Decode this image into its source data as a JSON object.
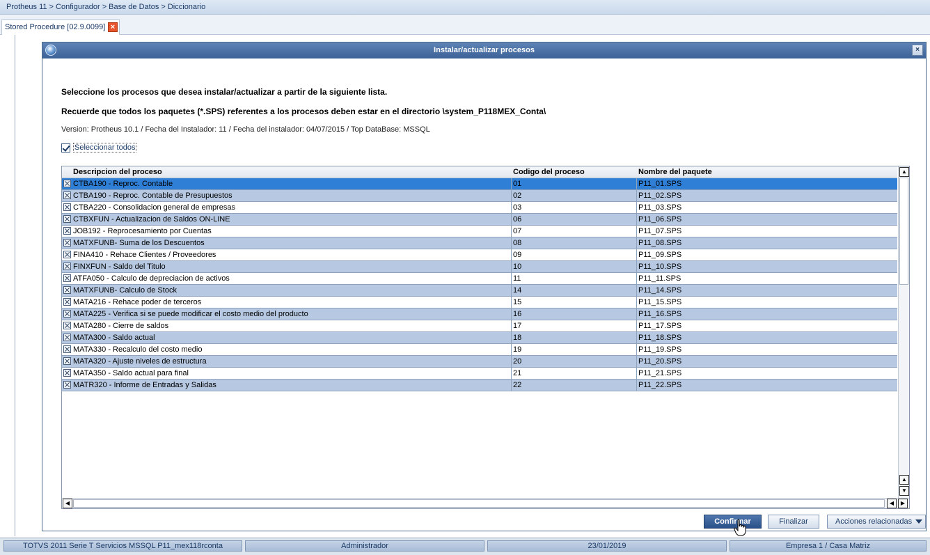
{
  "breadcrumb": "Protheus 11 > Configurador > Base de Datos > Diccionario",
  "tab": {
    "label": "Stored Procedure [02.9.0099]",
    "close_glyph": "×"
  },
  "dialog": {
    "title": "Instalar/actualizar procesos",
    "close_glyph": "×",
    "instruction1": "Seleccione los procesos que desea instalar/actualizar a partir de la siguiente lista.",
    "instruction2": "Recuerde que todos los paquetes (*.SPS) referentes a los procesos deben estar en el directorio \\system_P118MEX_Conta\\",
    "version_info": "Version: Protheus 10.1 / Fecha del Instalador: 11 / Fecha del instalador: 04/07/2015 / Top DataBase: MSSQL",
    "select_all_label": "Seleccionar todos",
    "select_all_checked": true
  },
  "table": {
    "columns": [
      "Descripcion del proceso",
      "Codigo del proceso",
      "Nombre del paquete"
    ],
    "selected_index": 0,
    "rows": [
      {
        "desc": "CTBA190 - Reproc. Contable",
        "code": "01",
        "pkg": "P11_01.SPS"
      },
      {
        "desc": "CTBA190 - Reproc. Contable de Presupuestos",
        "code": "02",
        "pkg": "P11_02.SPS"
      },
      {
        "desc": "CTBA220 - Consolidacion general de empresas",
        "code": "03",
        "pkg": "P11_03.SPS"
      },
      {
        "desc": "CTBXFUN - Actualizacion de Saldos ON-LINE",
        "code": "06",
        "pkg": "P11_06.SPS"
      },
      {
        "desc": "JOB192 - Reprocesamiento por Cuentas",
        "code": "07",
        "pkg": "P11_07.SPS"
      },
      {
        "desc": "MATXFUNB- Suma de los Descuentos",
        "code": "08",
        "pkg": "P11_08.SPS"
      },
      {
        "desc": "FINA410 - Rehace Clientes / Proveedores",
        "code": "09",
        "pkg": "P11_09.SPS"
      },
      {
        "desc": "FINXFUN - Saldo del Titulo",
        "code": "10",
        "pkg": "P11_10.SPS"
      },
      {
        "desc": "ATFA050 - Calculo de depreciacion de activos",
        "code": "11",
        "pkg": "P11_11.SPS"
      },
      {
        "desc": "MATXFUNB- Calculo de Stock",
        "code": "14",
        "pkg": "P11_14.SPS"
      },
      {
        "desc": "MATA216 - Rehace poder de terceros",
        "code": "15",
        "pkg": "P11_15.SPS"
      },
      {
        "desc": "MATA225 - Verifica si se puede modificar el costo medio del producto",
        "code": "16",
        "pkg": "P11_16.SPS"
      },
      {
        "desc": "MATA280 - Cierre de saldos",
        "code": "17",
        "pkg": "P11_17.SPS"
      },
      {
        "desc": "MATA300 - Saldo actual",
        "code": "18",
        "pkg": "P11_18.SPS"
      },
      {
        "desc": "MATA330 - Recalculo del costo medio",
        "code": "19",
        "pkg": "P11_19.SPS"
      },
      {
        "desc": "MATA320 - Ajuste niveles de estructura",
        "code": "20",
        "pkg": "P11_20.SPS"
      },
      {
        "desc": "MATA350 - Saldo actual para final",
        "code": "21",
        "pkg": "P11_21.SPS"
      },
      {
        "desc": "MATR320 - Informe de Entradas y Salidas",
        "code": "22",
        "pkg": "P11_22.SPS"
      }
    ]
  },
  "buttons": {
    "confirm": "Confirmar",
    "finish": "Finalizar",
    "related": "Acciones relacionadas"
  },
  "status_bar": {
    "system": "TOTVS 2011 Serie T Servicios MSSQL P11_mex118rconta",
    "user": "Administrador",
    "date": "23/01/2019",
    "company": "Empresa 1 / Casa Matriz"
  },
  "colors": {
    "titlebar": "#3c6197",
    "row_alt": "#b7c9e2",
    "row_selected": "#2f7fd6"
  }
}
